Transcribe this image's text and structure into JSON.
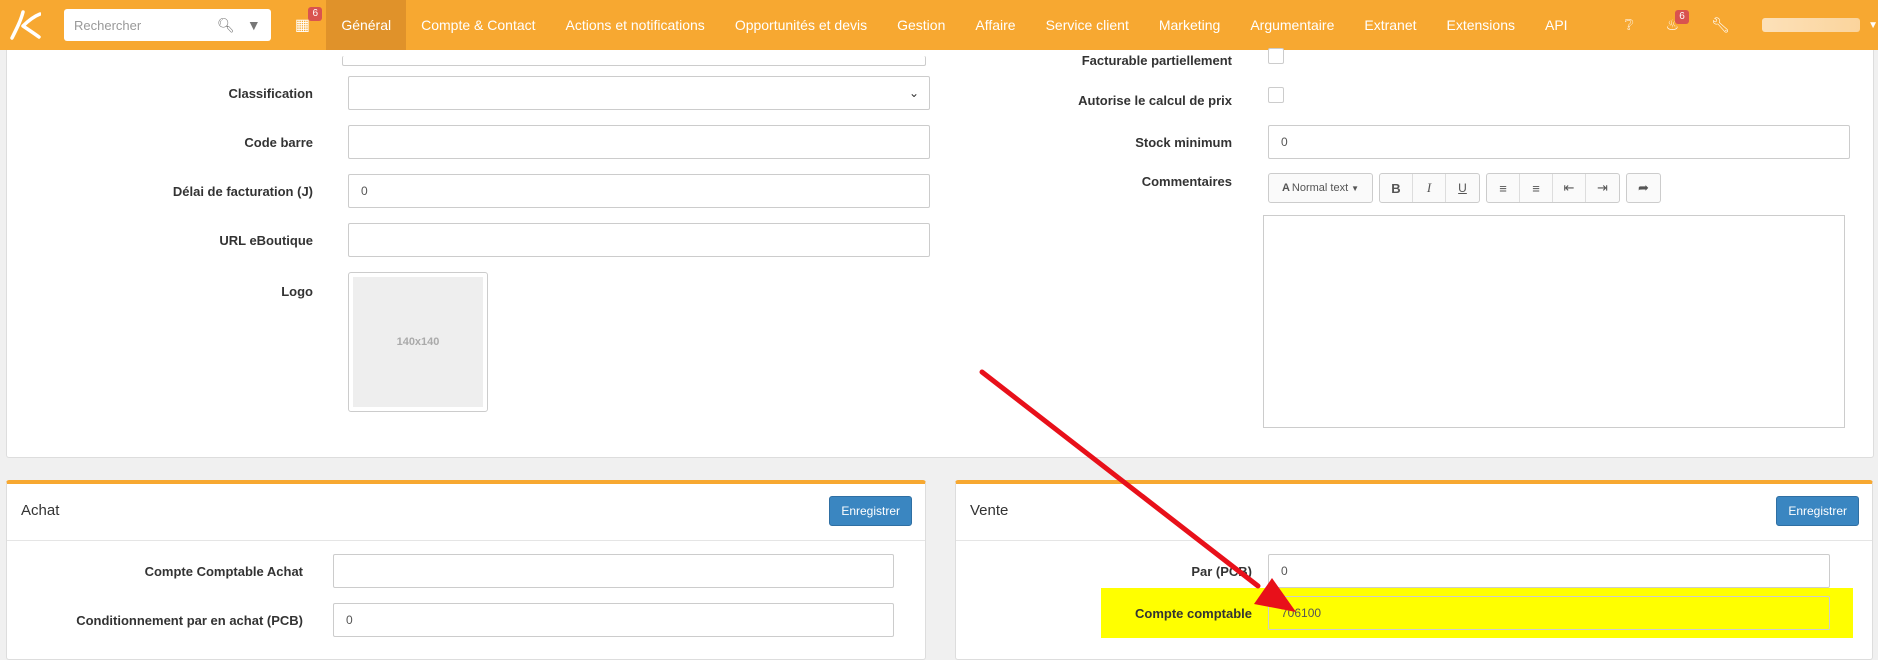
{
  "topbar": {
    "search_placeholder": "Rechercher",
    "calendar_badge": "6",
    "notifications_badge": "6",
    "nav": [
      "Général",
      "Compte & Contact",
      "Actions et notifications",
      "Opportunités et devis",
      "Gestion",
      "Affaire",
      "Service client",
      "Marketing",
      "Argumentaire",
      "Extranet",
      "Extensions",
      "API"
    ]
  },
  "form": {
    "classification_label": "Classification",
    "classification_value": "",
    "barcode_label": "Code barre",
    "barcode_value": "",
    "billing_delay_label": "Délai de facturation (J)",
    "billing_delay_value": "0",
    "url_label": "URL eBoutique",
    "url_value": "",
    "logo_label": "Logo",
    "logo_placeholder": "140x140",
    "partial_billing_label": "Facturable partiellement",
    "price_calc_label": "Autorise le calcul de prix",
    "min_stock_label": "Stock minimum",
    "min_stock_value": "0",
    "comments_label": "Commentaires",
    "editor_style": "Normal text"
  },
  "purchase": {
    "title": "Achat",
    "save_label": "Enregistrer",
    "account_label": "Compte Comptable Achat",
    "account_value": "",
    "pcb_label": "Conditionnement par en achat (PCB)",
    "pcb_value": "0"
  },
  "sale": {
    "title": "Vente",
    "save_label": "Enregistrer",
    "par_label": "Par (PCB)",
    "par_value": "0",
    "account_label": "Compte comptable",
    "account_value": "706100"
  },
  "colors": {
    "accent": "#f7a831",
    "button": "#3a86c1",
    "highlight": "#ffff00",
    "arrow": "#e8101a"
  }
}
